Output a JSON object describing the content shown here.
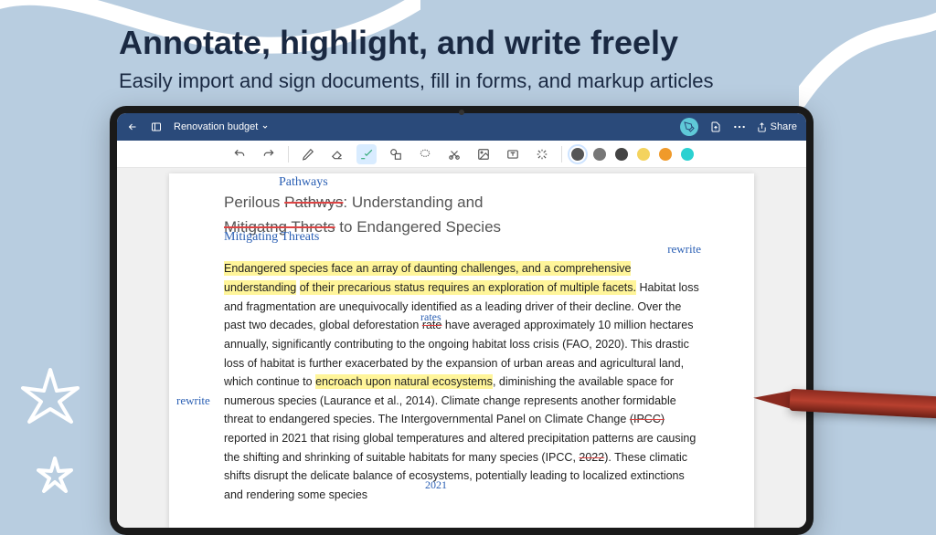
{
  "marketing": {
    "headline": "Annotate, highlight, and write freely",
    "subhead": "Easily import and sign documents, fill in forms, and markup articles"
  },
  "topbar": {
    "doc_title": "Renovation budget",
    "share_label": "Share"
  },
  "colors": {
    "c1": "#555555",
    "c2": "#777777",
    "c3": "#444444",
    "c4": "#f4d35e",
    "c5": "#f09a2a",
    "c6": "#2bd1d1"
  },
  "document": {
    "title_prefix": "Perilous ",
    "title_strike": "Pathwys",
    "title_mid": ": Understanding and ",
    "title_strike2": "Mitigatng Threts",
    "title_suffix": " to Endangered Species",
    "hand_pathways": "Pathways",
    "hand_mitigating": "Mitigating Threats",
    "hand_rewrite1": "rewrite",
    "hand_rewrite2": "rewrite",
    "hand_rates": "rates",
    "hand_2021": "2021",
    "p1_h1": "Endangered species face an array of daunting challenges, and a comprehensive understanding",
    "p1_h2": "of their precarious status requires an exploration of multiple facets.",
    "p1_t1": " Habitat loss and fragmentation are unequivocally identified as a leading driver of their decline. Over the past two decades, global deforestation ",
    "p1_strike_rate": "rate",
    "p1_t2": " have averaged approximately 10 million hectares annually, significantly contributing to the ongoing habitat loss crisis (FAO, 2020). This drastic loss of habitat is further exacerbated by the expansion of urban areas and agricultural land, which continue to ",
    "p1_h3": "encroach upon natural ecosystems",
    "p1_t3": ", diminishing the available space for numerous species (Laurance et al., 2014). Climate change represents another formidable threat to endangered species. The Intergovernmental Panel on Climate Change ",
    "p1_strike_ipcc": "(IPCC)",
    "p1_t4": " reported in 2021 that rising global temperatures and altered precipitation patterns are causing the shifting and shrinking of suitable habitats for many species (IPCC, ",
    "p1_strike_2022": "2022",
    "p1_t5": "). These climatic shifts disrupt the delicate balance of ecosystems, potentially leading to localized extinctions and rendering some species"
  }
}
